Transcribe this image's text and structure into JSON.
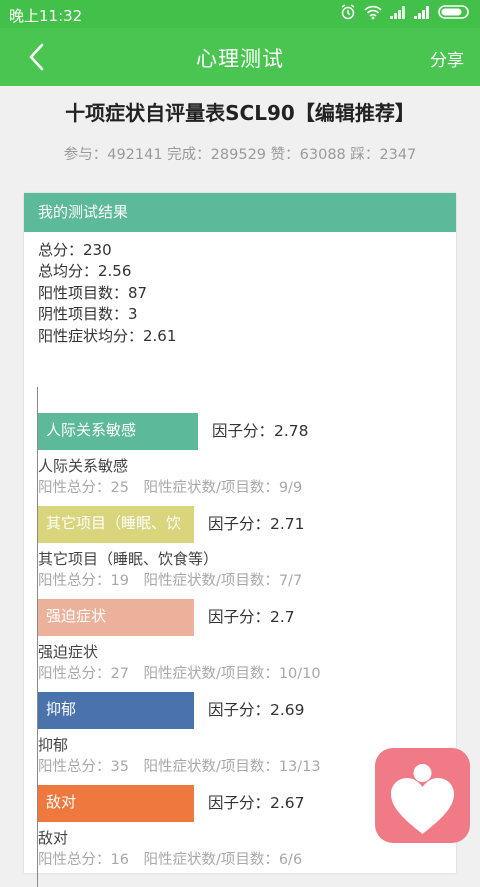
{
  "status_bar": {
    "time": "晚上11:32"
  },
  "app_bar": {
    "title": "心理测试",
    "share_label": "分享"
  },
  "test": {
    "title": "十项症状自评量表SCL90【编辑推荐】",
    "stats": "参与：492141 完成：289529 赞：63088 踩：2347"
  },
  "result": {
    "header": "我的测试结果",
    "summary": [
      "总分：230",
      "总均分：2.56",
      "阳性项目数：87",
      "阴性项目数：3",
      "阳性症状均分：2.61"
    ],
    "factors": [
      {
        "bar_label": "人际关系敏感",
        "score": "因子分：2.78",
        "name": "人际关系敏感",
        "detail": "阳性总分：25　阳性症状数/项目数：9/9",
        "color": "#5cb99a",
        "value": 2.78
      },
      {
        "bar_label": "其它项目（睡眠、饮",
        "score": "因子分：2.71",
        "name": "其它项目（睡眠、饮食等）",
        "detail": "阳性总分：19　阳性症状数/项目数：7/7",
        "color": "#d8d57c",
        "value": 2.71
      },
      {
        "bar_label": "强迫症状",
        "score": "因子分：2.7",
        "name": "强迫症状",
        "detail": "阳性总分：27　阳性症状数/项目数：10/10",
        "color": "#ebb19b",
        "value": 2.7
      },
      {
        "bar_label": "抑郁",
        "score": "因子分：2.69",
        "name": "抑郁",
        "detail": "阳性总分：35　阳性症状数/项目数：13/13",
        "color": "#4a73ad",
        "value": 2.69
      },
      {
        "bar_label": "敌对",
        "score": "因子分：2.67",
        "name": "敌对",
        "detail": "阳性总分：16　阳性症状数/项目数：6/6",
        "color": "#ee783d",
        "value": 2.67
      }
    ]
  },
  "floating_button": {
    "icon": "heart-person-icon",
    "color": "#f07a85"
  }
}
